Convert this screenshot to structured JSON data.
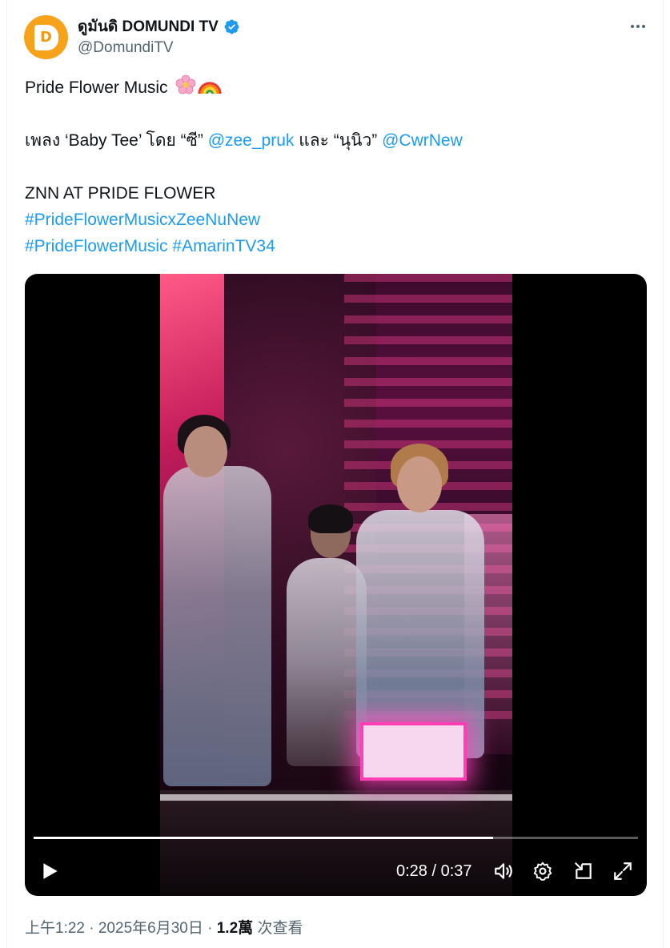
{
  "author": {
    "display_name": "ดูมันดิ DOMUNDI TV",
    "handle": "@DomundiTV",
    "avatar_letter": "D",
    "verified": true
  },
  "tweet": {
    "line1": "Pride Flower Music",
    "line2_prefix": "เพลง ‘Baby Tee’ โดย “ซี”",
    "mention1": "@zee_pruk",
    "line2_mid": "และ “นุนิว”",
    "mention2": "@CwrNew",
    "line3": "ZNN AT PRIDE FLOWER",
    "hashtag1": "#PrideFlowerMusicxZeeNuNew",
    "hashtag2": "#PrideFlowerMusic",
    "hashtag3": "#AmarinTV34",
    "emojis": [
      "flower-emoji",
      "rainbow-emoji"
    ]
  },
  "video": {
    "time_display": "0:28 / 0:37",
    "progress": 0.76
  },
  "meta": {
    "time": "上午1:22 · 2025年6月30日 ·",
    "views_count": "1.2萬",
    "views_label": "次查看"
  },
  "colors": {
    "link": "#1d9bf0",
    "verified": "#1d9bf0",
    "avatar_bg": "#f7a21b"
  }
}
